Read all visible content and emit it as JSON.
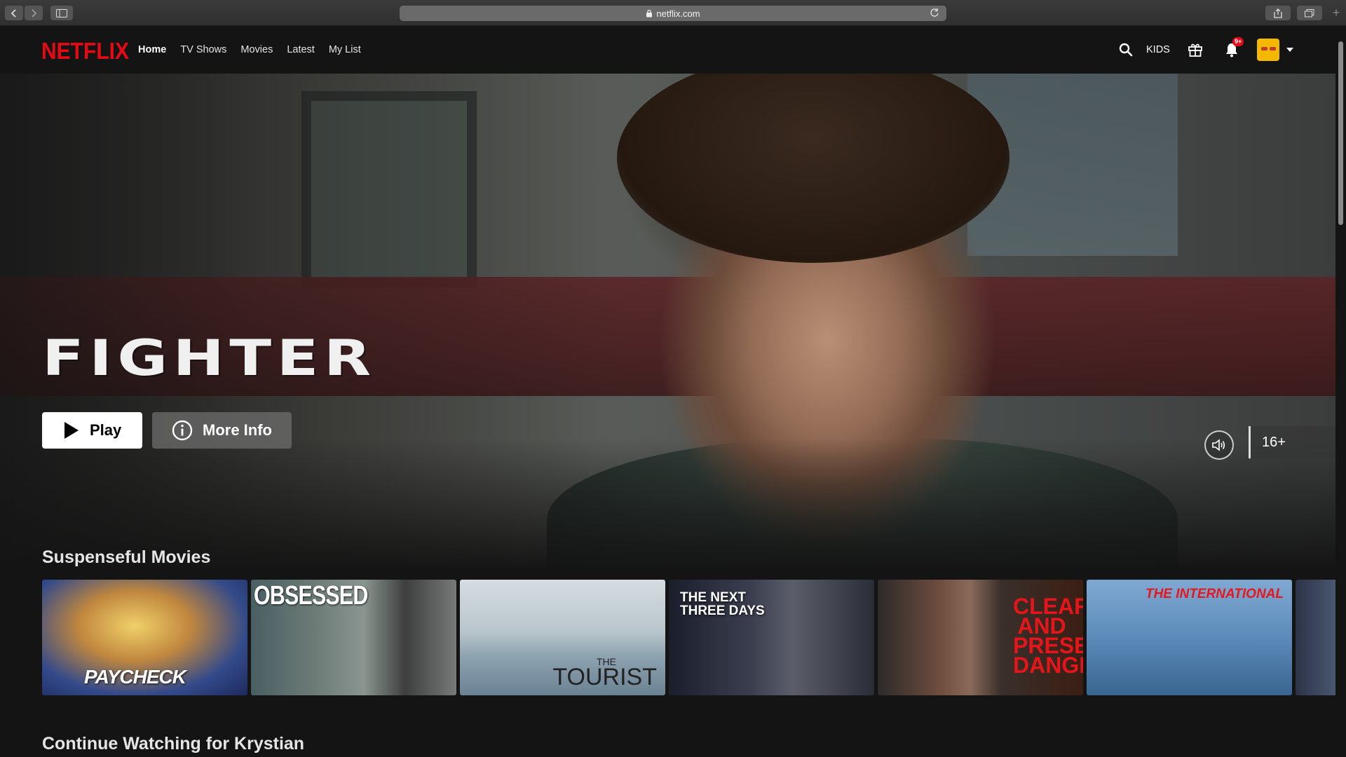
{
  "browser": {
    "url": "netflix.com"
  },
  "nav": {
    "logo": "NETFLIX",
    "items": [
      {
        "label": "Home",
        "active": true
      },
      {
        "label": "TV Shows",
        "active": false
      },
      {
        "label": "Movies",
        "active": false
      },
      {
        "label": "Latest",
        "active": false
      },
      {
        "label": "My List",
        "active": false
      }
    ],
    "kids_label": "KIDS",
    "notification_badge": "9+",
    "icons": [
      "search-icon",
      "gift-icon",
      "bell-icon",
      "avatar",
      "caret-down-icon"
    ]
  },
  "hero": {
    "title": "FIGHTER",
    "play_label": "Play",
    "more_info_label": "More Info",
    "maturity_rating": "16+"
  },
  "rows": [
    {
      "title": "Suspenseful Movies",
      "tiles": [
        {
          "title": "PAYCHECK"
        },
        {
          "title": "OBSESSED"
        },
        {
          "pre_title": "THE",
          "title": "TOURIST"
        },
        {
          "title": "THE NEXT THREE DAYS"
        },
        {
          "title": "CLEAR AND PRESENT DANGER"
        },
        {
          "title": "THE INTERNATIONAL"
        }
      ]
    },
    {
      "title": "Continue Watching for Krystian"
    }
  ],
  "colors": {
    "brand": "#e50914",
    "background": "#141414"
  }
}
